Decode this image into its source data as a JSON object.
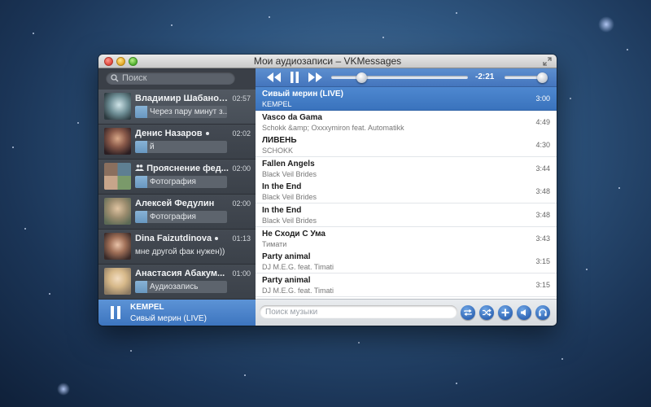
{
  "window": {
    "title": "Мои аудиозаписи – VKMessages"
  },
  "sidebar": {
    "search_placeholder": "Поиск",
    "conversations": [
      {
        "name": "Владимир Шабанов",
        "time": "02:57",
        "preview": "Через пару минут з..."
      },
      {
        "name": "Денис Назаров",
        "time": "02:02",
        "preview": "й"
      },
      {
        "name": "Прояснение фед...",
        "time": "02:00",
        "preview": "Фотография"
      },
      {
        "name": "Алексей Федулин",
        "time": "02:00",
        "preview": "Фотография"
      },
      {
        "name": "Dina Faizutdinova",
        "time": "01:13",
        "preview": "мне другой фак нужен))"
      },
      {
        "name": "Анастасия Абакум...",
        "time": "01:00",
        "preview": "Аудиозапись"
      }
    ],
    "now_playing": {
      "artist": "KEMPEL",
      "title": "Сивый мерин (LIVE)"
    }
  },
  "player": {
    "time_remaining": "-2:21",
    "progress": 0.22,
    "volume": 0.92
  },
  "tracks": [
    {
      "title": "Сивый мерин (LIVE)",
      "artist": "KEMPEL",
      "duration": "3:00",
      "selected": true
    },
    {
      "title": "Vasco da Gama",
      "artist": "Schokk &amp; Oxxxymiron feat. Automatikk",
      "duration": "4:49"
    },
    {
      "title": "ЛИВЕНЬ",
      "artist": "SCHOKK",
      "duration": "4:30"
    },
    {
      "title": "Fallen Angels",
      "artist": "Black Veil Brides",
      "duration": "3:44"
    },
    {
      "title": "In the End",
      "artist": "Black Veil Brides",
      "duration": "3:48"
    },
    {
      "title": "In the End",
      "artist": "Black Veil Brides",
      "duration": "3:48"
    },
    {
      "title": "Не Сходи С Ума",
      "artist": "Тимати",
      "duration": "3:43"
    },
    {
      "title": "Party animal",
      "artist": "DJ M.E.G. feat. Timati",
      "duration": "3:15"
    },
    {
      "title": "Party animal",
      "artist": "DJ M.E.G. feat. Timati",
      "duration": "3:15"
    }
  ],
  "bottombar": {
    "search_placeholder": "Поиск музыки",
    "buttons": [
      "repeat-icon",
      "shuffle-icon",
      "add-icon",
      "broadcast-icon",
      "headphones-icon"
    ]
  },
  "colors": {
    "accent": "#3d75bf",
    "selected_row": "#4e88d0",
    "sidebar_bg": "#3a3f47"
  }
}
